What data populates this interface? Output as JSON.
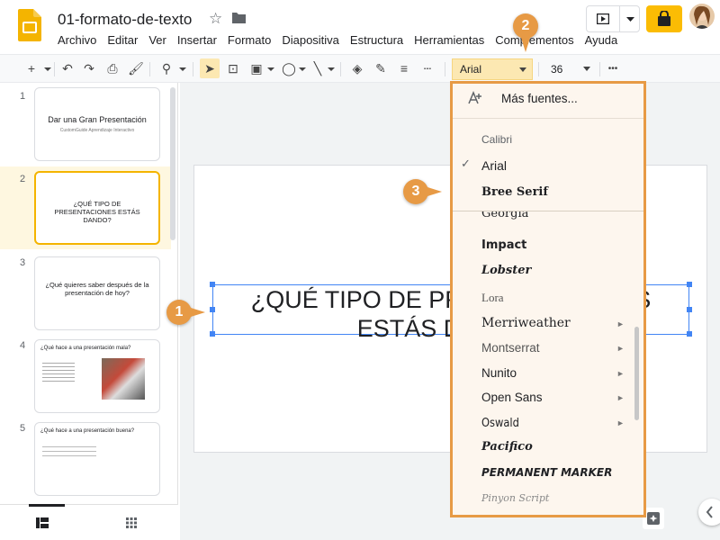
{
  "app": {
    "doc_title": "01-formato-de-texto"
  },
  "menu": [
    "Archivo",
    "Editar",
    "Ver",
    "Insertar",
    "Formato",
    "Diapositiva",
    "Estructura",
    "Herramientas",
    "Complementos",
    "Ayuda"
  ],
  "toolbar": {
    "font": "Arial",
    "size": "36",
    "more": "•••"
  },
  "slides": [
    {
      "num": "1",
      "title": "Dar una Gran Presentación",
      "subtitle": "CustomGuide Aprendizaje Interactivo"
    },
    {
      "num": "2",
      "title": "¿QUÉ TIPO DE PRESENTACIONES ESTÁS DANDO?",
      "subtitle": ""
    },
    {
      "num": "3",
      "title": "¿Qué quieres saber después de la presentación de hoy?",
      "subtitle": ""
    },
    {
      "num": "4",
      "title": "¿Qué hace a una presentación mala?",
      "subtitle": ""
    },
    {
      "num": "5",
      "title": "¿Qué hace a una presentación buena?",
      "subtitle": ""
    }
  ],
  "slide": {
    "line1": "¿QUÉ TIPO DE PRESENTACIONES",
    "line2": "ESTÁS DANDO?"
  },
  "font_menu": {
    "more_fonts": "Más fuentes...",
    "recent": [
      "Calibri",
      "Arial",
      "Bree Serif"
    ],
    "fonts": [
      "Georgia",
      "Impact",
      "Lobster",
      "Lora",
      "Merriweather",
      "Montserrat",
      "Nunito",
      "Open Sans",
      "Oswald",
      "Pacifico",
      "Permanent Marker",
      "Pinyon Script"
    ]
  },
  "callouts": [
    "1",
    "2",
    "3"
  ],
  "colors": {
    "accent_orange": "#e79a45",
    "selection_blue": "#4285f4",
    "font_highlight": "#fce8b2"
  }
}
